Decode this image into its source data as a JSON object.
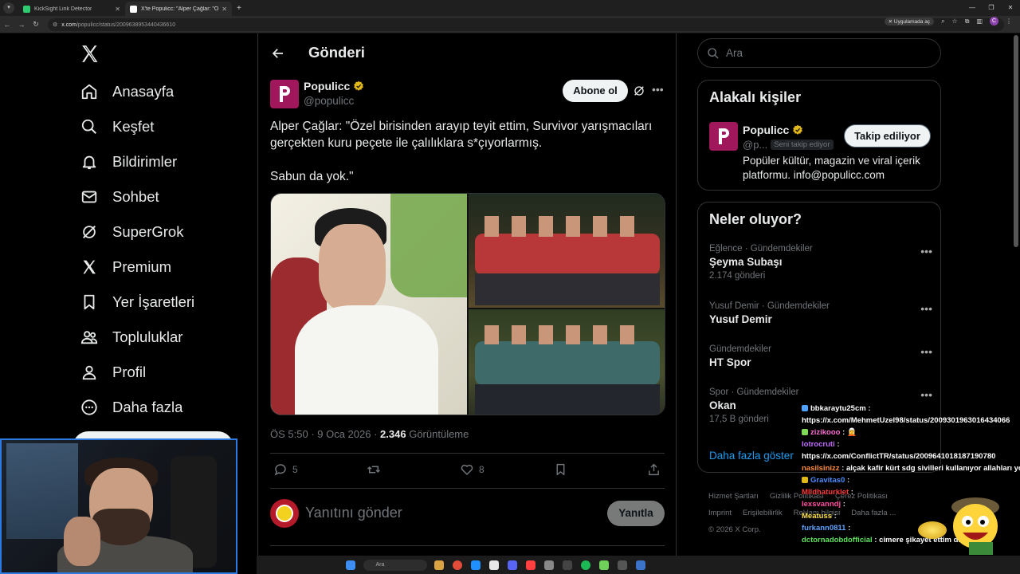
{
  "browser": {
    "tabs": [
      {
        "title": "KickSight Link Detector",
        "favicon_color": "#2ecc71"
      },
      {
        "title": "X'te Populicc: \"Alper Çağlar: \"Ö",
        "favicon_color": "#ffffff"
      }
    ],
    "url_domain": "x.com",
    "url_path": "/populicc/status/2009638953440436610",
    "app_button": "Uygulamada aç",
    "profile_initial": "C"
  },
  "nav": {
    "items": [
      {
        "label": "Anasayfa",
        "icon": "home-icon"
      },
      {
        "label": "Keşfet",
        "icon": "search-icon"
      },
      {
        "label": "Bildirimler",
        "icon": "bell-icon"
      },
      {
        "label": "Sohbet",
        "icon": "mail-icon"
      },
      {
        "label": "SuperGrok",
        "icon": "grok-icon"
      },
      {
        "label": "Premium",
        "icon": "x-icon"
      },
      {
        "label": "Yer İşaretleri",
        "icon": "bookmark-icon"
      },
      {
        "label": "Topluluklar",
        "icon": "people-icon"
      },
      {
        "label": "Profil",
        "icon": "person-icon"
      },
      {
        "label": "Daha fazla",
        "icon": "more-circle-icon"
      }
    ]
  },
  "post": {
    "header_title": "Gönderi",
    "author_name": "Populicc",
    "author_handle": "@populicc",
    "subscribe_label": "Abone ol",
    "text_line1": "Alper Çağlar: \"Özel birisinden arayıp teyit ettim, Survivor yarışmacıları gerçekten kuru peçete ile çalılıklara s*çıyorlarmış.",
    "text_line2": "Sabun da yok.\"",
    "time": "ÖS 5:50",
    "date": "9 Oca 2026",
    "views": "2.346",
    "views_label": "Görüntüleme",
    "replies": "5",
    "likes": "8",
    "reply_placeholder": "Yanıtını gönder",
    "reply_button": "Yanıtla"
  },
  "sidebar": {
    "search_placeholder": "Ara",
    "related_title": "Alakalı kişiler",
    "related": {
      "name": "Populicc",
      "handle": "@p...",
      "follows_you": "Seni takip ediyor",
      "follow_button": "Takip ediliyor",
      "bio": "Popüler kültür, magazin ve viral içerik platformu. info@populicc.com"
    },
    "trends_title": "Neler oluyor?",
    "trends": [
      {
        "context": "Eğlence · Gündemdekiler",
        "name": "Şeyma Subaşı",
        "count": "2.174 gönderi"
      },
      {
        "context": "Yusuf Demir · Gündemdekiler",
        "name": "Yusuf Demir",
        "count": ""
      },
      {
        "context": "Gündemdekiler",
        "name": "HT Spor",
        "count": ""
      },
      {
        "context": "Spor · Gündemdekiler",
        "name": "Okan",
        "count": "17,5 B gönderi"
      }
    ],
    "show_more": "Daha fazla göster",
    "footer": [
      "Hizmet Şartları",
      "Gizlilik Politikası",
      "Çerez Politikası",
      "Imprint",
      "Erişilebilirlik",
      "Reklam bilgisi",
      "Daha fazla ...",
      "© 2026 X Corp."
    ]
  },
  "chat": [
    {
      "user": "bbkaraytu25cm",
      "color": "#ffffff",
      "msg": "https://x.com/MehmetUzel98/status/2009301963016434066"
    },
    {
      "user": "zizikooo",
      "color": "#ff6fd8",
      "msg": ""
    },
    {
      "user": "lotrocruti",
      "color": "#c26bff",
      "msg": "https://x.com/ConflictTR/status/2009641018187190780"
    },
    {
      "user": "nasilsinizz",
      "color": "#ff8c3a",
      "msg": "alçak kafir kürt sdg sivilleri kullanıyor allahları yok vallahi"
    },
    {
      "user": "Gravitas0",
      "color": "#4f8cff",
      "msg": ""
    },
    {
      "user": "Mlldhaturklet",
      "color": "#ff3a3a",
      "msg": ""
    },
    {
      "user": "lexsvanndj",
      "color": "#ff4fa0",
      "msg": ""
    },
    {
      "user": "Meatuss",
      "color": "#ffe14f",
      "msg": ""
    },
    {
      "user": "furkann0811",
      "color": "#5fa3ff",
      "msg": ""
    },
    {
      "user": "dctornadobdofficial",
      "color": "#5fe35f",
      "msg": "cimere şikayet ettim dinle alay"
    }
  ],
  "taskbar": {
    "search_label": "Ara"
  }
}
